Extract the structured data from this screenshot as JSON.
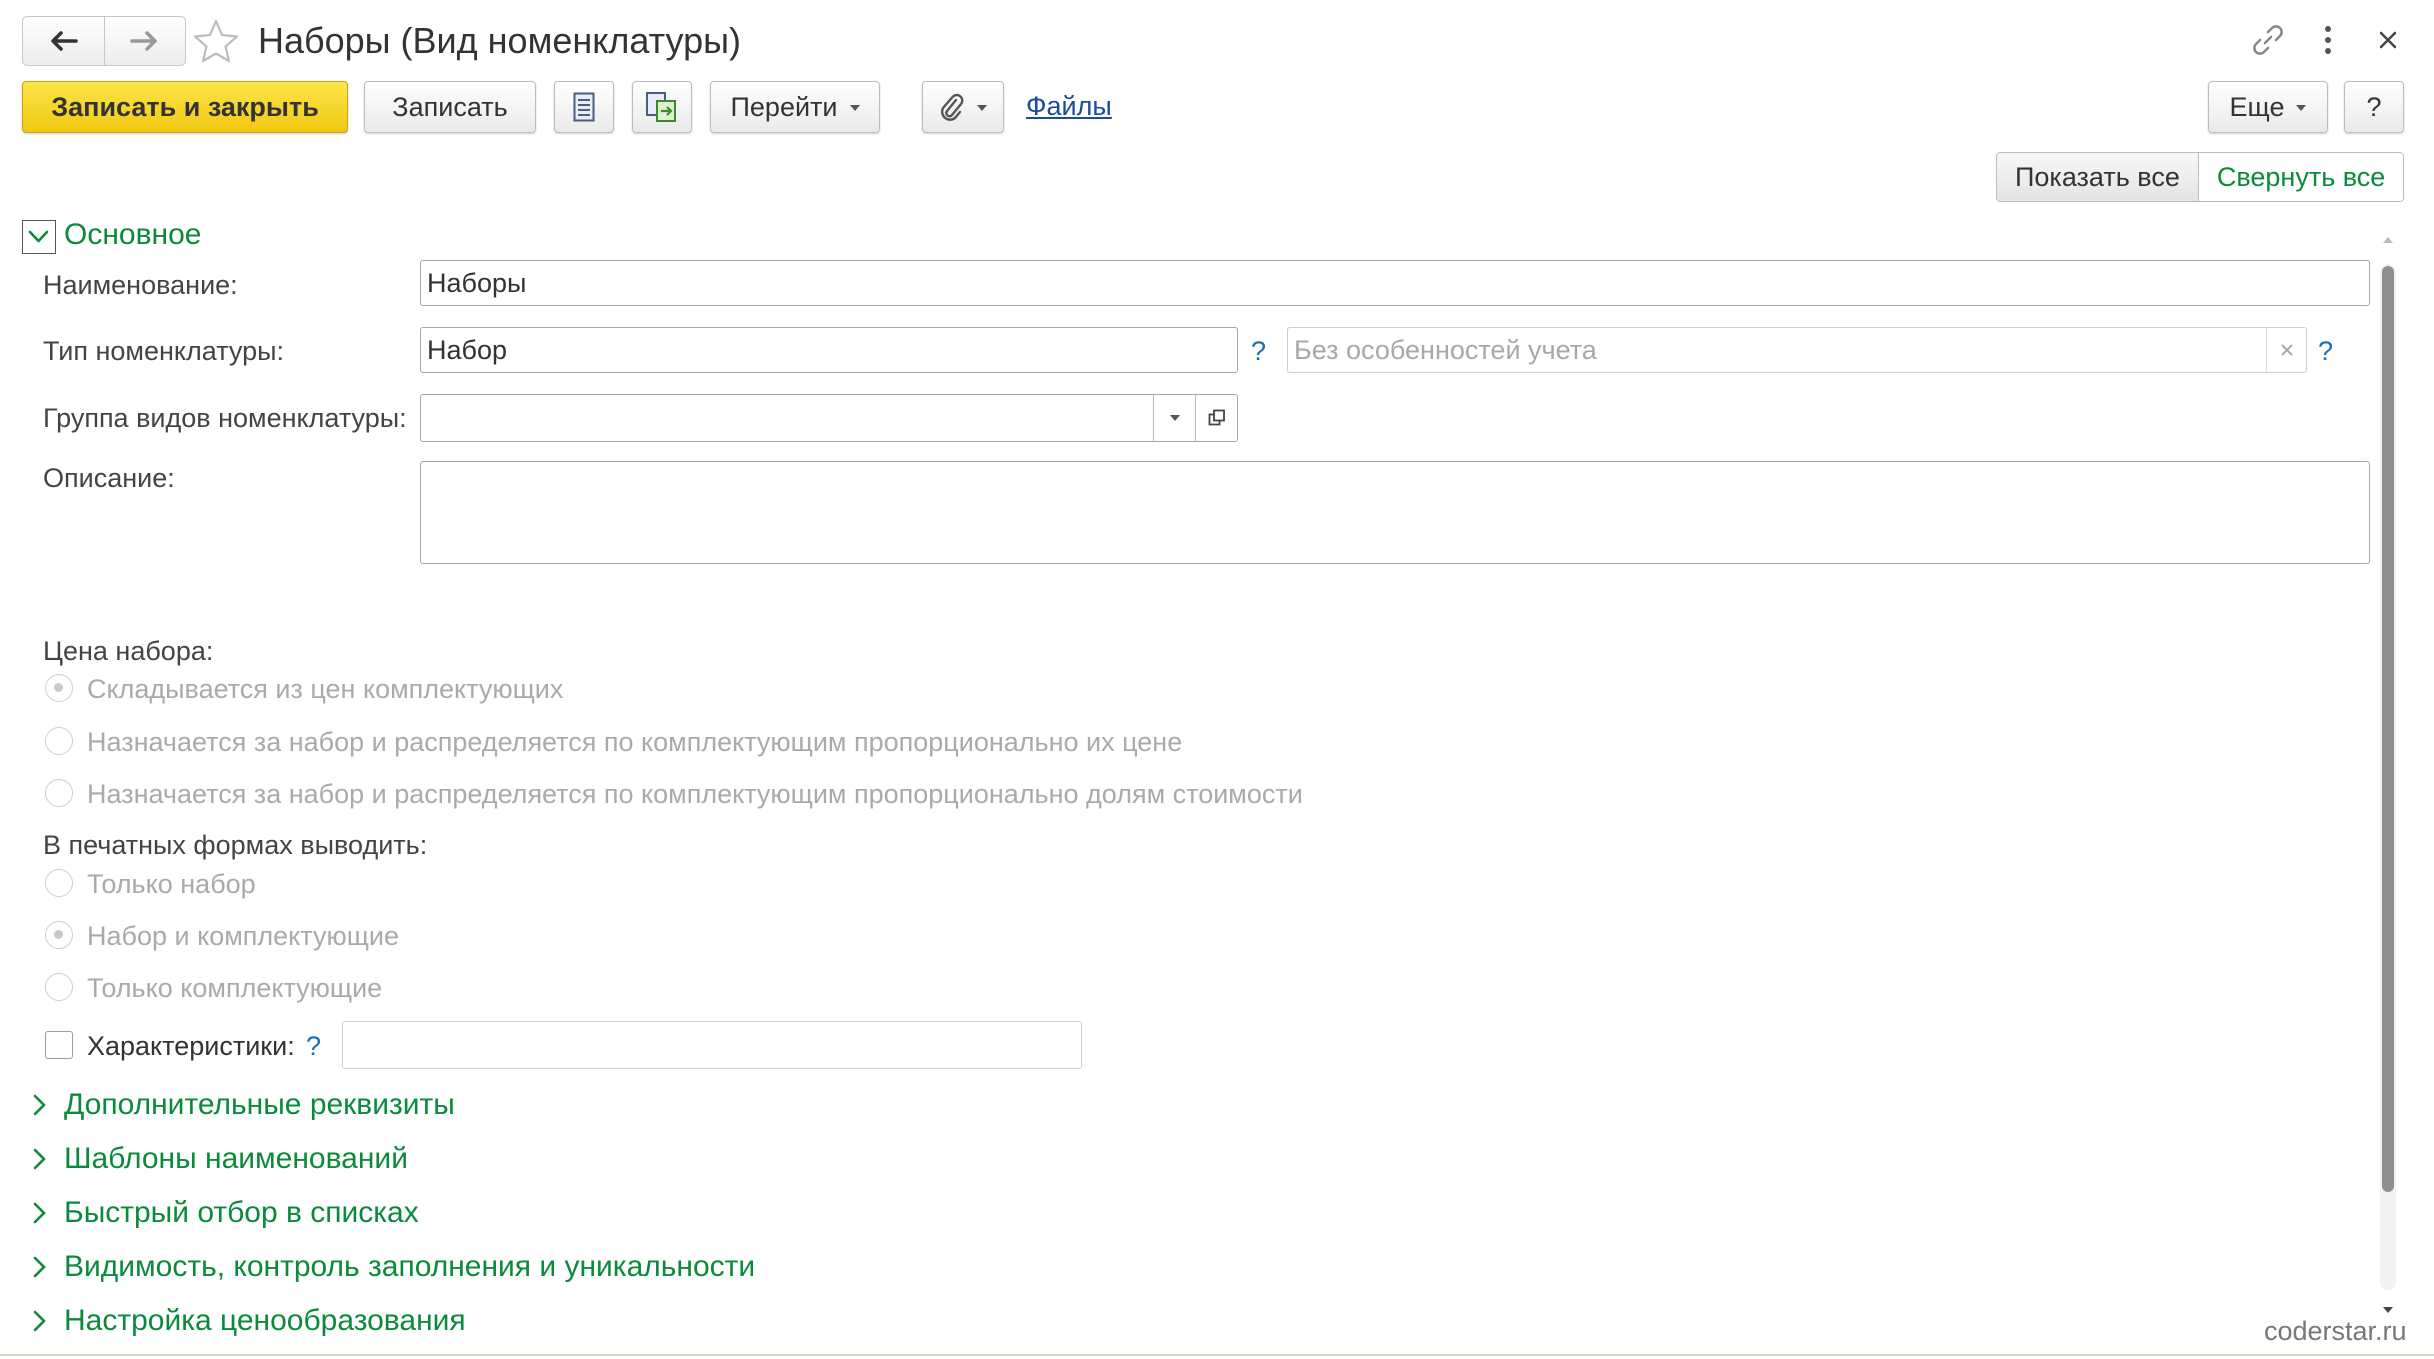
{
  "window": {
    "title": "Наборы (Вид номенклатуры)"
  },
  "toolbar": {
    "save_close": "Записать и закрыть",
    "save": "Записать",
    "goto": "Перейти",
    "files": "Файлы",
    "more": "Еще",
    "help": "?"
  },
  "view_toggle": {
    "show_all": "Показать все",
    "collapse_all": "Свернуть все"
  },
  "main_group": {
    "title": "Основное",
    "name_label": "Наименование:",
    "name_value": "Наборы",
    "type_label": "Тип номенклатуры:",
    "type_value": "Набор",
    "type_help": "?",
    "accounting_placeholder": "Без особенностей учета",
    "accounting_help": "?",
    "group_label": "Группа видов номенклатуры:",
    "group_value": "",
    "description_label": "Описание:",
    "description_value": ""
  },
  "price": {
    "label": "Цена набора:",
    "options": [
      "Складывается из цен комплектующих",
      "Назначается за набор и распределяется по комплектующим пропорционально их цене",
      "Назначается за набор и распределяется по комплектующим пропорционально долям стоимости"
    ],
    "selected_index": 0
  },
  "print": {
    "label": "В печатных формах выводить:",
    "options": [
      "Только набор",
      "Набор и комплектующие",
      "Только комплектующие"
    ],
    "selected_index": 1
  },
  "characteristics": {
    "label": "Характеристики:",
    "help": "?",
    "checked": false,
    "value": ""
  },
  "sections": [
    "Дополнительные реквизиты",
    "Шаблоны наименований",
    "Быстрый отбор в списках",
    "Видимость, контроль заполнения и уникальности",
    "Настройка ценообразования"
  ],
  "watermark": "coderstar.ru",
  "colors": {
    "accent_green": "#0c8a3c",
    "primary_yellow": "#f1c812",
    "link_blue": "#1a4b9c"
  }
}
